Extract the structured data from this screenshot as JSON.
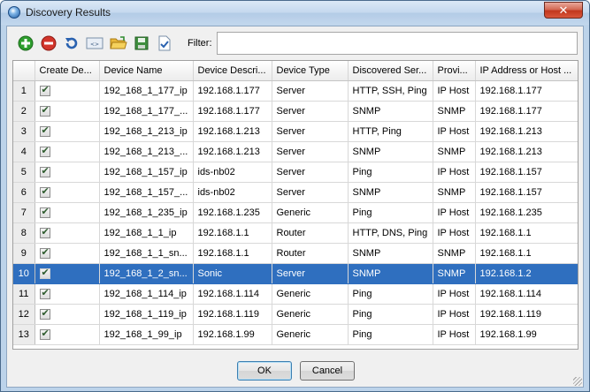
{
  "window": {
    "title": "Discovery Results",
    "close_label": "✕"
  },
  "toolbar": {
    "buttons": [
      {
        "name": "add-icon"
      },
      {
        "name": "remove-icon"
      },
      {
        "name": "refresh-icon"
      },
      {
        "name": "xml-icon"
      },
      {
        "name": "open-folder-icon"
      },
      {
        "name": "save-icon"
      },
      {
        "name": "export-icon"
      }
    ],
    "filter_label": "Filter:",
    "filter_value": ""
  },
  "table": {
    "columns": [
      "",
      "Create De...",
      "Device Name",
      "Device Descri...",
      "Device Type",
      "Discovered Ser...",
      "Provi...",
      "IP Address or Host ..."
    ],
    "rows": [
      {
        "num": "1",
        "name": "192_168_1_177_ip",
        "desc": "192.168.1.177",
        "type": "Server",
        "services": "HTTP, SSH, Ping",
        "provider": "IP Host",
        "ip": "192.168.1.177"
      },
      {
        "num": "2",
        "name": "192_168_1_177_...",
        "desc": "192.168.1.177",
        "type": "Server",
        "services": "SNMP",
        "provider": "SNMP",
        "ip": "192.168.1.177"
      },
      {
        "num": "3",
        "name": "192_168_1_213_ip",
        "desc": "192.168.1.213",
        "type": "Server",
        "services": "HTTP, Ping",
        "provider": "IP Host",
        "ip": "192.168.1.213"
      },
      {
        "num": "4",
        "name": "192_168_1_213_...",
        "desc": "192.168.1.213",
        "type": "Server",
        "services": "SNMP",
        "provider": "SNMP",
        "ip": "192.168.1.213"
      },
      {
        "num": "5",
        "name": "192_168_1_157_ip",
        "desc": "ids-nb02",
        "type": "Server",
        "services": "Ping",
        "provider": "IP Host",
        "ip": "192.168.1.157"
      },
      {
        "num": "6",
        "name": "192_168_1_157_...",
        "desc": "ids-nb02",
        "type": "Server",
        "services": "SNMP",
        "provider": "SNMP",
        "ip": "192.168.1.157"
      },
      {
        "num": "7",
        "name": "192_168_1_235_ip",
        "desc": "192.168.1.235",
        "type": "Generic",
        "services": "Ping",
        "provider": "IP Host",
        "ip": "192.168.1.235"
      },
      {
        "num": "8",
        "name": "192_168_1_1_ip",
        "desc": "192.168.1.1",
        "type": "Router",
        "services": "HTTP, DNS, Ping",
        "provider": "IP Host",
        "ip": "192.168.1.1"
      },
      {
        "num": "9",
        "name": "192_168_1_1_sn...",
        "desc": "192.168.1.1",
        "type": "Router",
        "services": "SNMP",
        "provider": "SNMP",
        "ip": "192.168.1.1"
      },
      {
        "num": "10",
        "name": "192_168_1_2_sn...",
        "desc": "Sonic",
        "type": "Server",
        "services": "SNMP",
        "provider": "SNMP",
        "ip": "192.168.1.2",
        "selected": true
      },
      {
        "num": "11",
        "name": "192_168_1_114_ip",
        "desc": "192.168.1.114",
        "type": "Generic",
        "services": "Ping",
        "provider": "IP Host",
        "ip": "192.168.1.114"
      },
      {
        "num": "12",
        "name": "192_168_1_119_ip",
        "desc": "192.168.1.119",
        "type": "Generic",
        "services": "Ping",
        "provider": "IP Host",
        "ip": "192.168.1.119"
      },
      {
        "num": "13",
        "name": "192_168_1_99_ip",
        "desc": "192.168.1.99",
        "type": "Generic",
        "services": "Ping",
        "provider": "IP Host",
        "ip": "192.168.1.99"
      }
    ]
  },
  "buttons": {
    "ok": "OK",
    "cancel": "Cancel"
  },
  "colors": {
    "selection": "#2f6fbf",
    "titlebar": "#c4d8ee",
    "close": "#c2371e"
  }
}
